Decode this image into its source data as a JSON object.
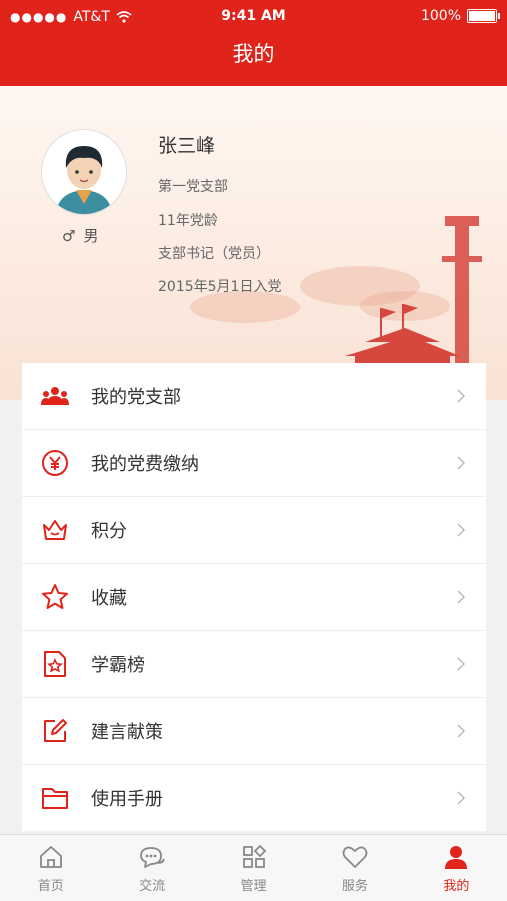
{
  "status_bar": {
    "carrier": "AT&T",
    "time": "9:41 AM",
    "battery": "100%"
  },
  "nav": {
    "title": "我的"
  },
  "profile": {
    "name": "张三峰",
    "gender": "男",
    "branch": "第一党支部",
    "party_age": "11年党龄",
    "role": "支部书记（党员）",
    "join_date": "2015年5月1日入党"
  },
  "menu": [
    {
      "label": "我的党支部",
      "icon": "party-branch-icon"
    },
    {
      "label": "我的党费缴纳",
      "icon": "yuan-icon"
    },
    {
      "label": "积分",
      "icon": "crown-points-icon"
    },
    {
      "label": "收藏",
      "icon": "star-icon"
    },
    {
      "label": "学霸榜",
      "icon": "ranking-icon"
    },
    {
      "label": "建言献策",
      "icon": "edit-icon"
    },
    {
      "label": "使用手册",
      "icon": "folder-icon"
    }
  ],
  "tabs": [
    {
      "label": "首页",
      "icon": "home-icon"
    },
    {
      "label": "交流",
      "icon": "chat-icon"
    },
    {
      "label": "管理",
      "icon": "grid-icon"
    },
    {
      "label": "服务",
      "icon": "heart-icon"
    },
    {
      "label": "我的",
      "icon": "user-icon",
      "active": true
    }
  ],
  "colors": {
    "brand": "#e0241b",
    "text": "#333333",
    "muted": "#888888"
  }
}
